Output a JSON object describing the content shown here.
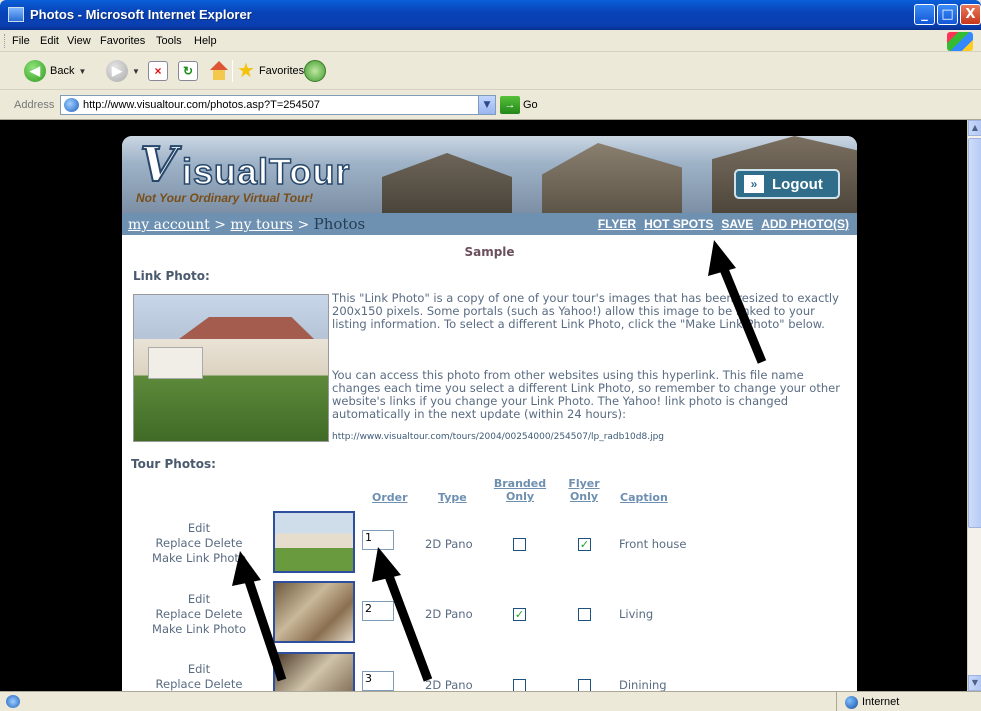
{
  "window": {
    "title": "Photos - Microsoft Internet Explorer",
    "minimize": "_",
    "maximize": "□",
    "close": "X"
  },
  "menu": [
    "File",
    "Edit",
    "View",
    "Favorites",
    "Tools",
    "Help"
  ],
  "toolbar": {
    "back": "Back",
    "favorites": "Favorites"
  },
  "address": {
    "label": "Address",
    "url": "http://www.visualtour.com/photos.asp?T=254507",
    "go": "Go"
  },
  "status": {
    "zone": "Internet"
  },
  "banner": {
    "logo_v": "V",
    "logo_word": "isualTour",
    "tagline": "Not Your Ordinary Virtual Tour!",
    "logout": "Logout"
  },
  "breadcrumb": {
    "account": "my account",
    "sep1": " > ",
    "tours": "my tours",
    "sep2": " > ",
    "current": "Photos"
  },
  "nav_links": [
    "FLYER",
    "HOT SPOTS",
    "SAVE",
    "ADD PHOTO(S)"
  ],
  "page": {
    "title": "Sample",
    "link_photo_heading": "Link Photo:",
    "link_photo_desc1": "This \"Link Photo\" is a copy of one of your tour's images that has been resized to exactly 200x150 pixels. Some portals (such as Yahoo!) allow this image to be linked to your listing information. To select a different Link Photo, click the \"Make Link Photo\" below.",
    "link_photo_desc2": "You can access this photo from other websites using this hyperlink. This file name changes each time you select a different Link Photo, so remember to change your other website's links if you change your Link Photo. The Yahoo! link photo is changed automatically in the next update (within 24 hours):",
    "link_photo_url": "http://www.visualtour.com/tours/2004/00254000/254507/lp_radb10d8.jpg",
    "tour_photos_heading": "Tour Photos:"
  },
  "table": {
    "headers": {
      "order": "Order",
      "type": "Type",
      "branded": "Branded Only",
      "flyer": "Flyer Only",
      "caption": "Caption"
    },
    "actions": {
      "edit": "Edit",
      "replace": "Replace",
      "delete": "Delete",
      "make_link": "Make Link Photo"
    },
    "rows": [
      {
        "order": "1",
        "type": "2D Pano",
        "branded": false,
        "flyer": true,
        "caption": "Front house"
      },
      {
        "order": "2",
        "type": "2D Pano",
        "branded": true,
        "flyer": false,
        "caption": "Living"
      },
      {
        "order": "3",
        "type": "2D Pano",
        "branded": false,
        "flyer": false,
        "caption": "Dinining"
      }
    ]
  },
  "colors": {
    "nav_strip": "#6e91b2",
    "accent_text": "#6e8fb0",
    "logout_bg": "#2f6d8a",
    "check": "#21a121"
  }
}
